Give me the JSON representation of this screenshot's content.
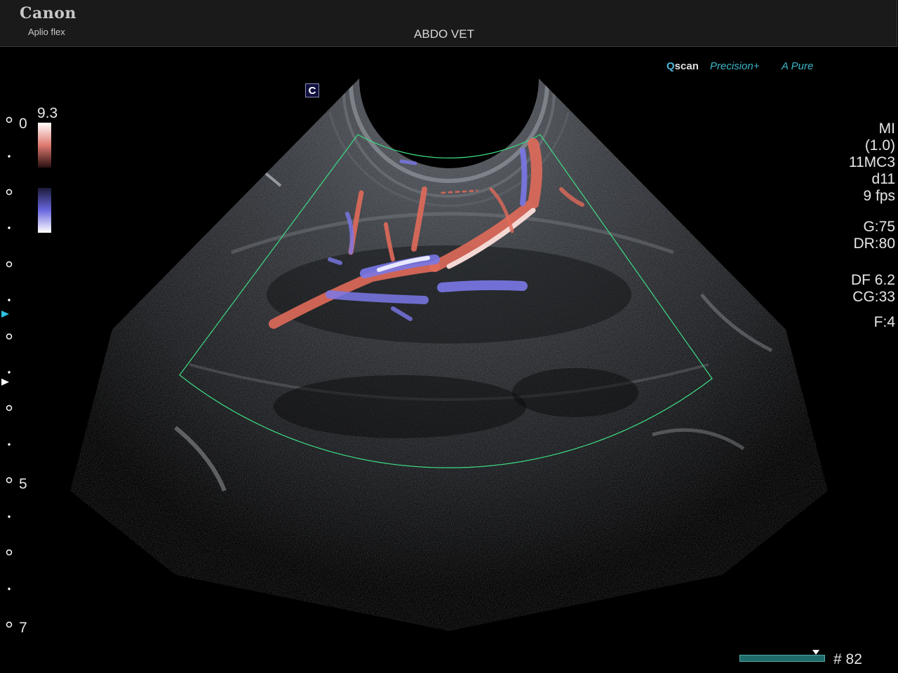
{
  "header": {
    "brand": "Canon",
    "model": "Aplio flex",
    "preset": "ABDO VET"
  },
  "mode_icon": "C",
  "image_tags": {
    "qscan_prefix": "Q",
    "qscan": "scan",
    "precision": "Precision+",
    "pure_prefix": "A",
    "pure": "Pure"
  },
  "color_scale": {
    "max": "9.3",
    "baseline": "0"
  },
  "depth_scale": {
    "label_5": "5",
    "label_7": "7"
  },
  "parameters": {
    "mi": "MI",
    "mi_value": "(1.0)",
    "transducer": "11MC3",
    "depth": "d11",
    "frame_rate": "9 fps",
    "gain": "G:75",
    "dynamic_range": "DR:80",
    "doppler_freq": "DF 6.2",
    "color_gain": "CG:33",
    "focus": "F:4"
  },
  "cine": {
    "frame": "# 82"
  },
  "colors": {
    "sector_outline": "#3ddc84",
    "flow_red": "#e06a5a",
    "flow_blue": "#7a78e8",
    "accent_cyan": "#2fc0e0"
  }
}
